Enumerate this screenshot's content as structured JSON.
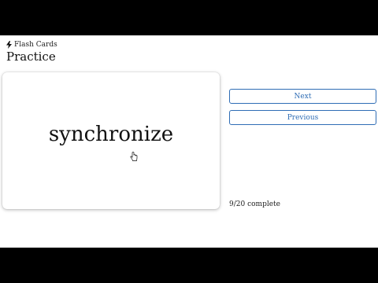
{
  "header": {
    "brand": "Flash Cards",
    "brand_icon": "bolt-icon",
    "title": "Practice"
  },
  "card": {
    "word": "synchronize"
  },
  "controls": {
    "next_label": "Next",
    "previous_label": "Previous"
  },
  "progress": {
    "text": "9/20 complete",
    "completed": 9,
    "total": 20
  },
  "colors": {
    "accent": "#2f6db5",
    "background": "#ffffff",
    "letterbox": "#000000"
  }
}
